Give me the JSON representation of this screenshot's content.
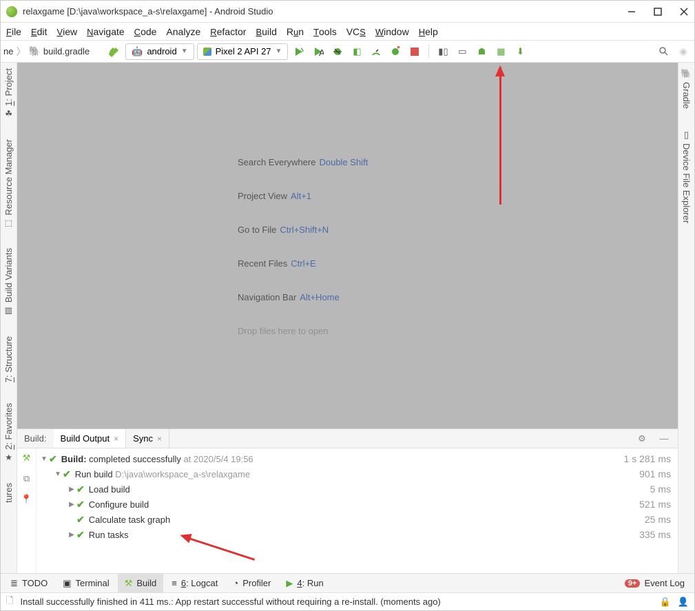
{
  "window": {
    "title": "relaxgame [D:\\java\\workspace_a-s\\relaxgame] - Android Studio"
  },
  "menu": {
    "file": "File",
    "edit": "Edit",
    "view": "View",
    "navigate": "Navigate",
    "code": "Code",
    "analyze": "Analyze",
    "refactor": "Refactor",
    "build": "Build",
    "run": "Run",
    "tools": "Tools",
    "vcs": "VCS",
    "window": "Window",
    "help": "Help"
  },
  "toolbar": {
    "bc0": "ne",
    "bc1": "build.gradle",
    "config": "android",
    "device": "Pixel 2 API 27"
  },
  "gutters": {
    "left": [
      {
        "label": "1: Project"
      },
      {
        "label": "Resource Manager"
      },
      {
        "label": "Build Variants"
      },
      {
        "label": "7: Structure"
      },
      {
        "label": "2: Favorites"
      },
      {
        "label": "tures"
      }
    ],
    "right": [
      {
        "label": "Gradle"
      },
      {
        "label": "Device File Explorer"
      }
    ]
  },
  "tips": [
    {
      "label": "Search Everywhere",
      "shortcut": "Double Shift"
    },
    {
      "label": "Project View",
      "shortcut": "Alt+1"
    },
    {
      "label": "Go to File",
      "shortcut": "Ctrl+Shift+N"
    },
    {
      "label": "Recent Files",
      "shortcut": "Ctrl+E"
    },
    {
      "label": "Navigation Bar",
      "shortcut": "Alt+Home"
    },
    {
      "label": "Drop files here to open",
      "shortcut": ""
    }
  ],
  "build": {
    "panel_label": "Build:",
    "tabs": [
      {
        "label": "Build Output"
      },
      {
        "label": "Sync"
      }
    ],
    "tree": [
      {
        "indent": 0,
        "caret": "▼",
        "label": "Build:",
        "suffix": " completed successfully",
        "path": " at 2020/5/4 19:56",
        "time": "1 s 281 ms",
        "bold": true
      },
      {
        "indent": 1,
        "caret": "▼",
        "label": "Run build",
        "path": " D:\\java\\workspace_a-s\\relaxgame",
        "time": "901 ms"
      },
      {
        "indent": 2,
        "caret": "▶",
        "label": "Load build",
        "path": "",
        "time": "5 ms"
      },
      {
        "indent": 2,
        "caret": "▶",
        "label": "Configure build",
        "path": "",
        "time": "521 ms"
      },
      {
        "indent": 2,
        "caret": "",
        "label": "Calculate task graph",
        "path": "",
        "time": "25 ms"
      },
      {
        "indent": 2,
        "caret": "▶",
        "label": "Run tasks",
        "path": "",
        "time": "335 ms"
      }
    ]
  },
  "bottom": {
    "todo": "TODO",
    "terminal": "Terminal",
    "build": "Build",
    "logcat": "6: Logcat",
    "profiler": "Profiler",
    "run": "4: Run",
    "eventlog": "Event Log"
  },
  "status": {
    "msg": "Install successfully finished in 411 ms.: App restart successful without requiring a re-install. (moments ago)"
  }
}
